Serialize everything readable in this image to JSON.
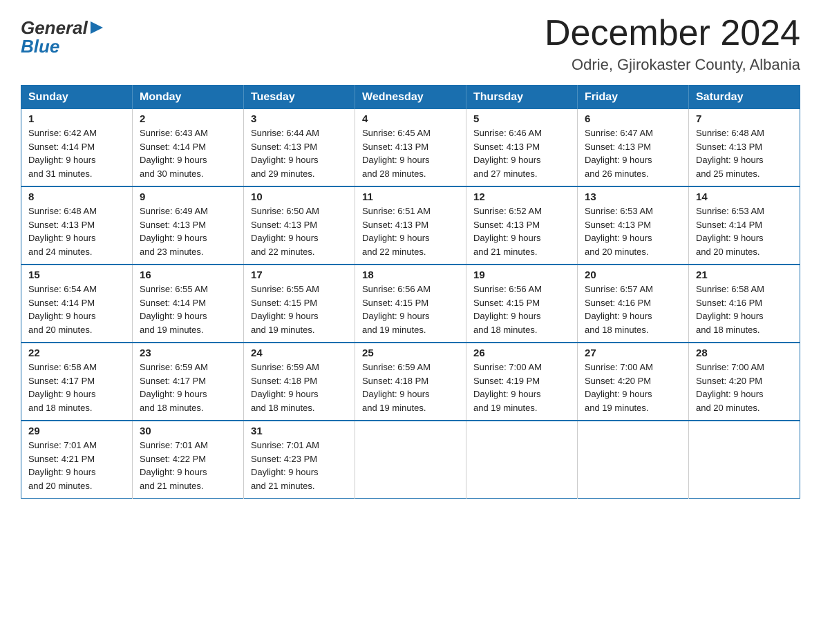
{
  "header": {
    "logo_general": "General",
    "logo_blue": "Blue",
    "month_title": "December 2024",
    "location": "Odrie, Gjirokaster County, Albania"
  },
  "days_of_week": [
    "Sunday",
    "Monday",
    "Tuesday",
    "Wednesday",
    "Thursday",
    "Friday",
    "Saturday"
  ],
  "weeks": [
    [
      {
        "day": 1,
        "sunrise": "6:42 AM",
        "sunset": "4:14 PM",
        "daylight": "9 hours and 31 minutes."
      },
      {
        "day": 2,
        "sunrise": "6:43 AM",
        "sunset": "4:14 PM",
        "daylight": "9 hours and 30 minutes."
      },
      {
        "day": 3,
        "sunrise": "6:44 AM",
        "sunset": "4:13 PM",
        "daylight": "9 hours and 29 minutes."
      },
      {
        "day": 4,
        "sunrise": "6:45 AM",
        "sunset": "4:13 PM",
        "daylight": "9 hours and 28 minutes."
      },
      {
        "day": 5,
        "sunrise": "6:46 AM",
        "sunset": "4:13 PM",
        "daylight": "9 hours and 27 minutes."
      },
      {
        "day": 6,
        "sunrise": "6:47 AM",
        "sunset": "4:13 PM",
        "daylight": "9 hours and 26 minutes."
      },
      {
        "day": 7,
        "sunrise": "6:48 AM",
        "sunset": "4:13 PM",
        "daylight": "9 hours and 25 minutes."
      }
    ],
    [
      {
        "day": 8,
        "sunrise": "6:48 AM",
        "sunset": "4:13 PM",
        "daylight": "9 hours and 24 minutes."
      },
      {
        "day": 9,
        "sunrise": "6:49 AM",
        "sunset": "4:13 PM",
        "daylight": "9 hours and 23 minutes."
      },
      {
        "day": 10,
        "sunrise": "6:50 AM",
        "sunset": "4:13 PM",
        "daylight": "9 hours and 22 minutes."
      },
      {
        "day": 11,
        "sunrise": "6:51 AM",
        "sunset": "4:13 PM",
        "daylight": "9 hours and 22 minutes."
      },
      {
        "day": 12,
        "sunrise": "6:52 AM",
        "sunset": "4:13 PM",
        "daylight": "9 hours and 21 minutes."
      },
      {
        "day": 13,
        "sunrise": "6:53 AM",
        "sunset": "4:13 PM",
        "daylight": "9 hours and 20 minutes."
      },
      {
        "day": 14,
        "sunrise": "6:53 AM",
        "sunset": "4:14 PM",
        "daylight": "9 hours and 20 minutes."
      }
    ],
    [
      {
        "day": 15,
        "sunrise": "6:54 AM",
        "sunset": "4:14 PM",
        "daylight": "9 hours and 20 minutes."
      },
      {
        "day": 16,
        "sunrise": "6:55 AM",
        "sunset": "4:14 PM",
        "daylight": "9 hours and 19 minutes."
      },
      {
        "day": 17,
        "sunrise": "6:55 AM",
        "sunset": "4:15 PM",
        "daylight": "9 hours and 19 minutes."
      },
      {
        "day": 18,
        "sunrise": "6:56 AM",
        "sunset": "4:15 PM",
        "daylight": "9 hours and 19 minutes."
      },
      {
        "day": 19,
        "sunrise": "6:56 AM",
        "sunset": "4:15 PM",
        "daylight": "9 hours and 18 minutes."
      },
      {
        "day": 20,
        "sunrise": "6:57 AM",
        "sunset": "4:16 PM",
        "daylight": "9 hours and 18 minutes."
      },
      {
        "day": 21,
        "sunrise": "6:58 AM",
        "sunset": "4:16 PM",
        "daylight": "9 hours and 18 minutes."
      }
    ],
    [
      {
        "day": 22,
        "sunrise": "6:58 AM",
        "sunset": "4:17 PM",
        "daylight": "9 hours and 18 minutes."
      },
      {
        "day": 23,
        "sunrise": "6:59 AM",
        "sunset": "4:17 PM",
        "daylight": "9 hours and 18 minutes."
      },
      {
        "day": 24,
        "sunrise": "6:59 AM",
        "sunset": "4:18 PM",
        "daylight": "9 hours and 18 minutes."
      },
      {
        "day": 25,
        "sunrise": "6:59 AM",
        "sunset": "4:18 PM",
        "daylight": "9 hours and 19 minutes."
      },
      {
        "day": 26,
        "sunrise": "7:00 AM",
        "sunset": "4:19 PM",
        "daylight": "9 hours and 19 minutes."
      },
      {
        "day": 27,
        "sunrise": "7:00 AM",
        "sunset": "4:20 PM",
        "daylight": "9 hours and 19 minutes."
      },
      {
        "day": 28,
        "sunrise": "7:00 AM",
        "sunset": "4:20 PM",
        "daylight": "9 hours and 20 minutes."
      }
    ],
    [
      {
        "day": 29,
        "sunrise": "7:01 AM",
        "sunset": "4:21 PM",
        "daylight": "9 hours and 20 minutes."
      },
      {
        "day": 30,
        "sunrise": "7:01 AM",
        "sunset": "4:22 PM",
        "daylight": "9 hours and 21 minutes."
      },
      {
        "day": 31,
        "sunrise": "7:01 AM",
        "sunset": "4:23 PM",
        "daylight": "9 hours and 21 minutes."
      },
      null,
      null,
      null,
      null
    ]
  ],
  "labels": {
    "sunrise": "Sunrise:",
    "sunset": "Sunset:",
    "daylight": "Daylight:"
  }
}
